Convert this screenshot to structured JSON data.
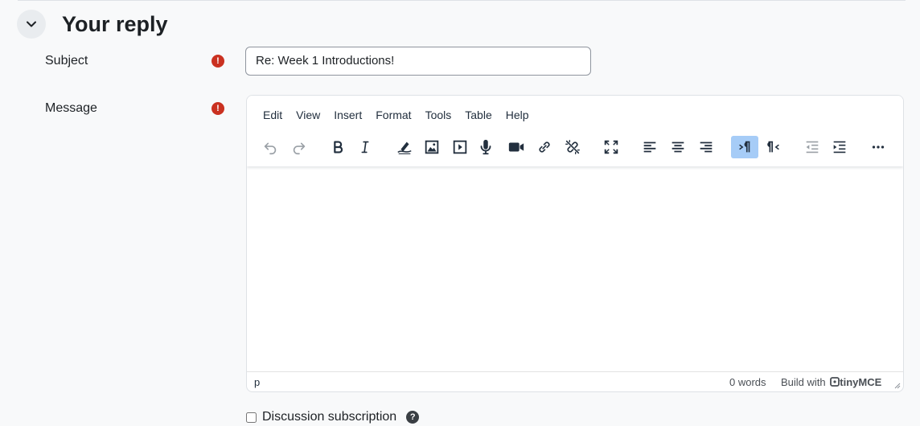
{
  "section": {
    "title": "Your reply",
    "collapse_icon": "chevron-down-icon"
  },
  "subject": {
    "label": "Subject",
    "value": "Re: Week 1 Introductions!",
    "required_mark": "!"
  },
  "message": {
    "label": "Message",
    "required_mark": "!"
  },
  "editor": {
    "menu": [
      "Edit",
      "View",
      "Insert",
      "Format",
      "Tools",
      "Table",
      "Help"
    ],
    "toolbar_icons": [
      "undo-icon",
      "redo-icon",
      "bold-icon",
      "italic-icon",
      "draw-icon",
      "image-icon",
      "media-icon",
      "record-audio-icon",
      "record-video-icon",
      "link-icon",
      "unlink-icon",
      "fullscreen-icon",
      "align-left-icon",
      "align-center-icon",
      "align-right-icon",
      "ltr-icon",
      "rtl-icon",
      "outdent-icon",
      "indent-icon",
      "more-icon"
    ],
    "active_button": "ltr",
    "status": {
      "path": "p",
      "words": "0 words",
      "built_with": "Build with",
      "brand": "tinyMCE"
    }
  },
  "subscription": {
    "label": "Discussion subscription",
    "checked": false,
    "help": "?"
  },
  "colors": {
    "required": "#ca3120",
    "active_button": "#a6ccf7"
  }
}
